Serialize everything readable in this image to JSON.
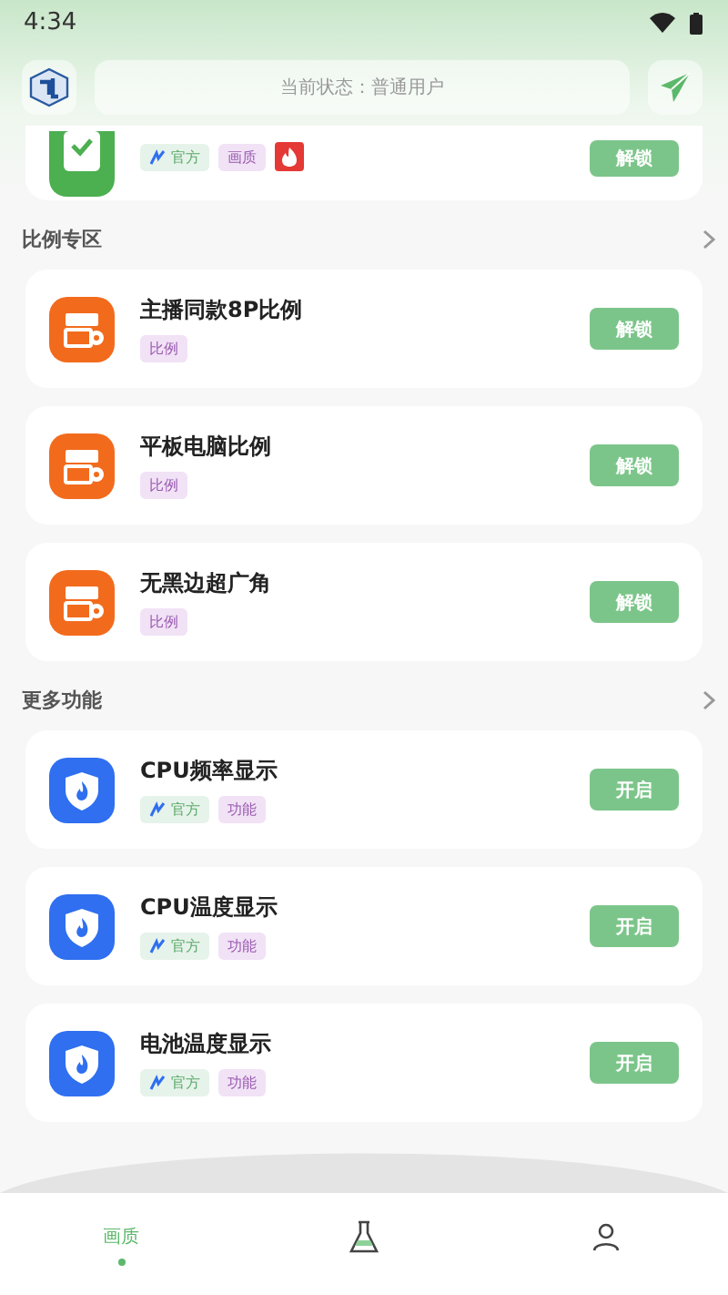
{
  "status_bar": {
    "time": "4:34"
  },
  "header": {
    "status_text": "当前状态：普通用户"
  },
  "top_card": {
    "tags": [
      {
        "kind": "official",
        "label": "官方"
      },
      {
        "kind": "category",
        "label": "画质"
      },
      {
        "kind": "hot"
      }
    ],
    "button": "解锁"
  },
  "sections": [
    {
      "title": "比例专区",
      "items": [
        {
          "kind": "ratio",
          "title": "主播同款8P比例",
          "tags": [
            {
              "kind": "category",
              "label": "比例"
            }
          ],
          "button": "解锁"
        },
        {
          "kind": "ratio",
          "title": "平板电脑比例",
          "tags": [
            {
              "kind": "category",
              "label": "比例"
            }
          ],
          "button": "解锁"
        },
        {
          "kind": "ratio",
          "title": "无黑边超广角",
          "tags": [
            {
              "kind": "category",
              "label": "比例"
            }
          ],
          "button": "解锁"
        }
      ]
    },
    {
      "title": "更多功能",
      "items": [
        {
          "kind": "shield",
          "title": "CPU频率显示",
          "tags": [
            {
              "kind": "official",
              "label": "官方"
            },
            {
              "kind": "category",
              "label": "功能"
            }
          ],
          "button": "开启"
        },
        {
          "kind": "shield",
          "title": "CPU温度显示",
          "tags": [
            {
              "kind": "official",
              "label": "官方"
            },
            {
              "kind": "category",
              "label": "功能"
            }
          ],
          "button": "开启"
        },
        {
          "kind": "shield",
          "title": "电池温度显示",
          "tags": [
            {
              "kind": "official",
              "label": "官方"
            },
            {
              "kind": "category",
              "label": "功能"
            }
          ],
          "button": "开启"
        }
      ]
    }
  ],
  "bottom_nav": [
    {
      "kind": "text",
      "label": "画质",
      "selected": true
    },
    {
      "kind": "flask",
      "selected": false
    },
    {
      "kind": "person",
      "selected": false
    }
  ]
}
